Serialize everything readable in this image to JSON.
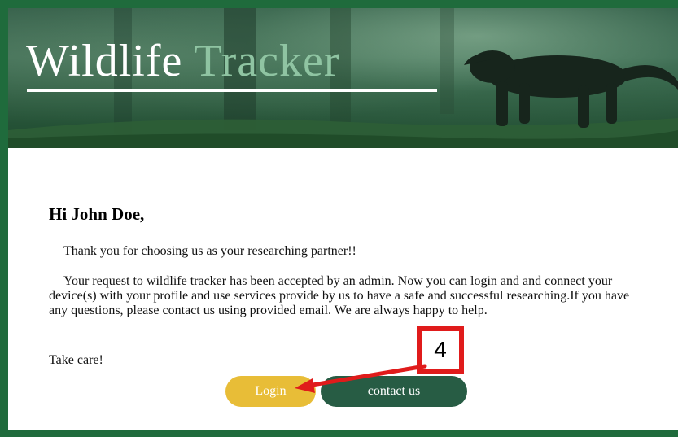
{
  "header": {
    "title_part1": "Wildlife",
    "title_part2": "Tracker"
  },
  "email": {
    "greeting": "Hi John Doe,",
    "paragraph1": "Thank you for choosing us as your researching partner!!",
    "paragraph2": "Your request to wildlife tracker has been accepted by an admin. Now you can login and and connect your device(s) with your profile and use services provide by us to have a safe and successful researching.If you have any questions, please contact us using provided email. We are always happy to help.",
    "closing": "Take care!"
  },
  "buttons": {
    "login_label": "Login",
    "contact_label": "contact us"
  },
  "annotation": {
    "step_number": "4"
  },
  "colors": {
    "frame": "#1f6b3c",
    "title_accent": "#8fc4a2",
    "login_button": "#e8bd37",
    "contact_button": "#275c44",
    "annotation": "#e01b1b"
  }
}
